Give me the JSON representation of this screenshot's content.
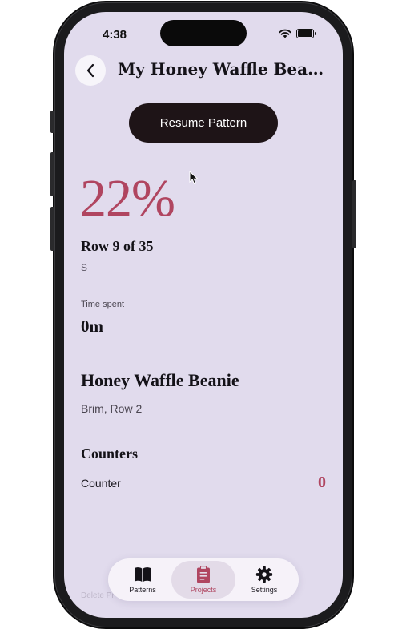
{
  "status_bar": {
    "time": "4:38"
  },
  "nav": {
    "title": "My Honey Waffle Beanie"
  },
  "actions": {
    "resume_label": "Resume Pattern"
  },
  "progress": {
    "percent_text": "22%",
    "percent": 22,
    "row_label": "Row 9 of 35",
    "current_row": 9,
    "total_rows": 35,
    "size": "S"
  },
  "time_spent": {
    "label": "Time spent",
    "value": "0m"
  },
  "pattern": {
    "name": "Honey Waffle Beanie",
    "position": "Brim, Row 2"
  },
  "counters": {
    "heading": "Counters",
    "items": [
      {
        "label": "Counter",
        "value": "0"
      }
    ]
  },
  "footer": {
    "delete_label": "Delete Pr"
  },
  "tabbar": {
    "tabs": [
      {
        "label": "Patterns",
        "icon": "book-icon",
        "active": false
      },
      {
        "label": "Projects",
        "icon": "clipboard-icon",
        "active": true
      },
      {
        "label": "Settings",
        "icon": "gear-icon",
        "active": false
      }
    ]
  },
  "colors": {
    "accent": "#b04560",
    "background": "#e1dbed",
    "primary_button": "#1e1417",
    "text": "#141218"
  }
}
